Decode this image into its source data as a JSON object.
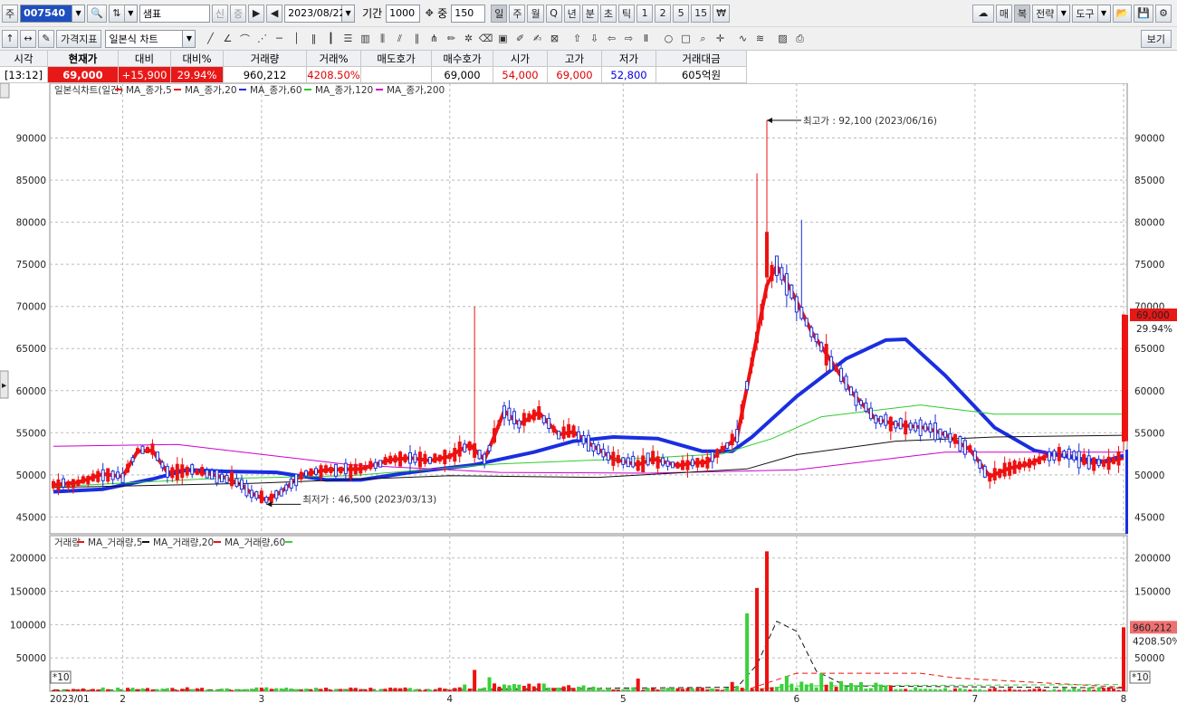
{
  "toolbar": {
    "market_label": "주",
    "stock_code": "007540",
    "stock_name": "샘표",
    "date": "2023/08/22",
    "period_label": "기간",
    "period_value": "1000",
    "overlay_label": "중",
    "overlay_value": "150",
    "timeframes": [
      "일",
      "주",
      "월",
      "Q",
      "년",
      "분",
      "초",
      "틱",
      "1",
      "2",
      "5",
      "15"
    ],
    "right_buttons": [
      "매",
      "복",
      "전략",
      "도구"
    ],
    "indicator_button": "가격지표",
    "chart_type": "일본식 차트",
    "view_button": "보기",
    "side_tab": "▸"
  },
  "quote": {
    "headers": [
      "시각",
      "현재가",
      "대비",
      "대비%",
      "거래량",
      "거래%",
      "매도호가",
      "매수호가",
      "시가",
      "고가",
      "저가",
      "거래대금"
    ],
    "values": [
      "[13:12]",
      "69,000",
      "+15,900",
      "29.94%",
      "960,212",
      "4208.50%",
      "",
      "69,000",
      "54,000",
      "69,000",
      "52,800",
      "605억원"
    ]
  },
  "price_chart": {
    "legend": [
      "일본식차트(일간)",
      "MA_종가,5",
      "MA_종가,20",
      "MA_종가,60",
      "MA_종가,120",
      "MA_종가,200"
    ],
    "high_annotation": "최고가 : 92,100 (2023/06/16)",
    "low_annotation": "최저가 : 46,500 (2023/03/13)",
    "current_price_tag": "69,000",
    "current_pct_tag": "29.94%"
  },
  "volume_chart": {
    "legend": [
      "거래량",
      "MA_거래량,5",
      "MA_거래량,20",
      "MA_거래량,60"
    ],
    "volume_tag": "960,212",
    "pct_tag": "4208.50%",
    "scale_tag": "*10"
  },
  "colors": {
    "up": "#ee1111",
    "down": "#1a30d8",
    "ma5": "#ee1111",
    "ma20": "#ee1111",
    "ma60": "#1a2ee0",
    "ma120": "#2ecc2e",
    "ma200": "#cc00cc"
  },
  "chart_data": {
    "type": "candlestick",
    "title": "일본식차트(일간)",
    "x_labels": [
      "2023/01",
      "2",
      "3",
      "4",
      "5",
      "6",
      "7",
      "8"
    ],
    "price_ylim": [
      43000,
      95000
    ],
    "price_ticks": [
      45000,
      50000,
      55000,
      60000,
      65000,
      70000,
      75000,
      80000,
      85000,
      90000
    ],
    "volume_ylim": [
      0,
      220000
    ],
    "volume_ticks": [
      50000,
      100000,
      150000,
      200000
    ],
    "highest": {
      "value": 92100,
      "date": "2023/06/16"
    },
    "lowest": {
      "value": 46500,
      "date": "2023/03/13"
    },
    "ma_series": [
      {
        "name": "MA_종가,5",
        "points": [
          [
            0,
            48800
          ],
          [
            5,
            49100
          ],
          [
            10,
            50100
          ],
          [
            14,
            49800
          ],
          [
            17,
            52800
          ],
          [
            20,
            52900
          ],
          [
            23,
            50300
          ],
          [
            27,
            50600
          ],
          [
            31,
            50200
          ],
          [
            35,
            49600
          ],
          [
            38,
            48800
          ],
          [
            40,
            47800
          ],
          [
            43,
            47000
          ],
          [
            46,
            48000
          ],
          [
            50,
            50000
          ],
          [
            55,
            50600
          ],
          [
            62,
            50700
          ],
          [
            68,
            51800
          ],
          [
            72,
            52000
          ],
          [
            76,
            51700
          ],
          [
            80,
            52200
          ],
          [
            84,
            53600
          ],
          [
            87,
            51800
          ],
          [
            89,
            54600
          ],
          [
            91,
            57600
          ],
          [
            94,
            56000
          ],
          [
            98,
            57400
          ],
          [
            102,
            54800
          ],
          [
            105,
            55100
          ],
          [
            109,
            53400
          ],
          [
            113,
            51900
          ],
          [
            118,
            51200
          ],
          [
            121,
            51900
          ],
          [
            126,
            51100
          ],
          [
            129,
            51400
          ],
          [
            132,
            51500
          ],
          [
            135,
            53000
          ],
          [
            138,
            54500
          ],
          [
            141,
            63400
          ],
          [
            144,
            72500
          ],
          [
            146,
            74800
          ],
          [
            149,
            71800
          ],
          [
            153,
            67000
          ],
          [
            157,
            63500
          ],
          [
            161,
            59900
          ],
          [
            166,
            56600
          ],
          [
            171,
            55900
          ],
          [
            176,
            55600
          ],
          [
            180,
            54800
          ],
          [
            185,
            53000
          ],
          [
            189,
            49800
          ],
          [
            193,
            50800
          ],
          [
            197,
            51300
          ],
          [
            201,
            52400
          ],
          [
            205,
            52300
          ],
          [
            209,
            51400
          ],
          [
            213,
            51600
          ],
          [
            216,
            52000
          ]
        ]
      },
      {
        "name": "MA_종가,60",
        "points": [
          [
            0,
            48000
          ],
          [
            10,
            48300
          ],
          [
            20,
            49500
          ],
          [
            27,
            50600
          ],
          [
            35,
            50400
          ],
          [
            45,
            50300
          ],
          [
            55,
            49400
          ],
          [
            62,
            49400
          ],
          [
            72,
            50300
          ],
          [
            85,
            51200
          ],
          [
            97,
            52700
          ],
          [
            105,
            54000
          ],
          [
            113,
            54500
          ],
          [
            122,
            54300
          ],
          [
            131,
            52800
          ],
          [
            137,
            52800
          ],
          [
            141,
            54500
          ],
          [
            150,
            59300
          ],
          [
            160,
            63800
          ],
          [
            168,
            66000
          ],
          [
            172,
            66100
          ],
          [
            180,
            61800
          ],
          [
            190,
            55600
          ],
          [
            198,
            52900
          ],
          [
            206,
            52000
          ],
          [
            212,
            51600
          ],
          [
            216,
            52300
          ]
        ]
      },
      {
        "name": "MA_종가,120",
        "points": [
          [
            0,
            48600
          ],
          [
            30,
            49500
          ],
          [
            60,
            49900
          ],
          [
            90,
            51300
          ],
          [
            120,
            52000
          ],
          [
            135,
            52500
          ],
          [
            145,
            54300
          ],
          [
            155,
            56900
          ],
          [
            175,
            58300
          ],
          [
            190,
            57200
          ],
          [
            216,
            57200
          ]
        ]
      },
      {
        "name": "MA_종가,200",
        "points": [
          [
            0,
            53400
          ],
          [
            25,
            53600
          ],
          [
            60,
            51200
          ],
          [
            90,
            50300
          ],
          [
            120,
            50200
          ],
          [
            150,
            50600
          ],
          [
            180,
            52700
          ],
          [
            216,
            52700
          ]
        ]
      },
      {
        "name": "MA_종가,20",
        "points": [
          [
            0,
            48500
          ],
          [
            40,
            49000
          ],
          [
            80,
            49900
          ],
          [
            110,
            49700
          ],
          [
            140,
            50700
          ],
          [
            150,
            52400
          ],
          [
            170,
            54000
          ],
          [
            190,
            54500
          ],
          [
            216,
            54700
          ]
        ]
      }
    ]
  }
}
